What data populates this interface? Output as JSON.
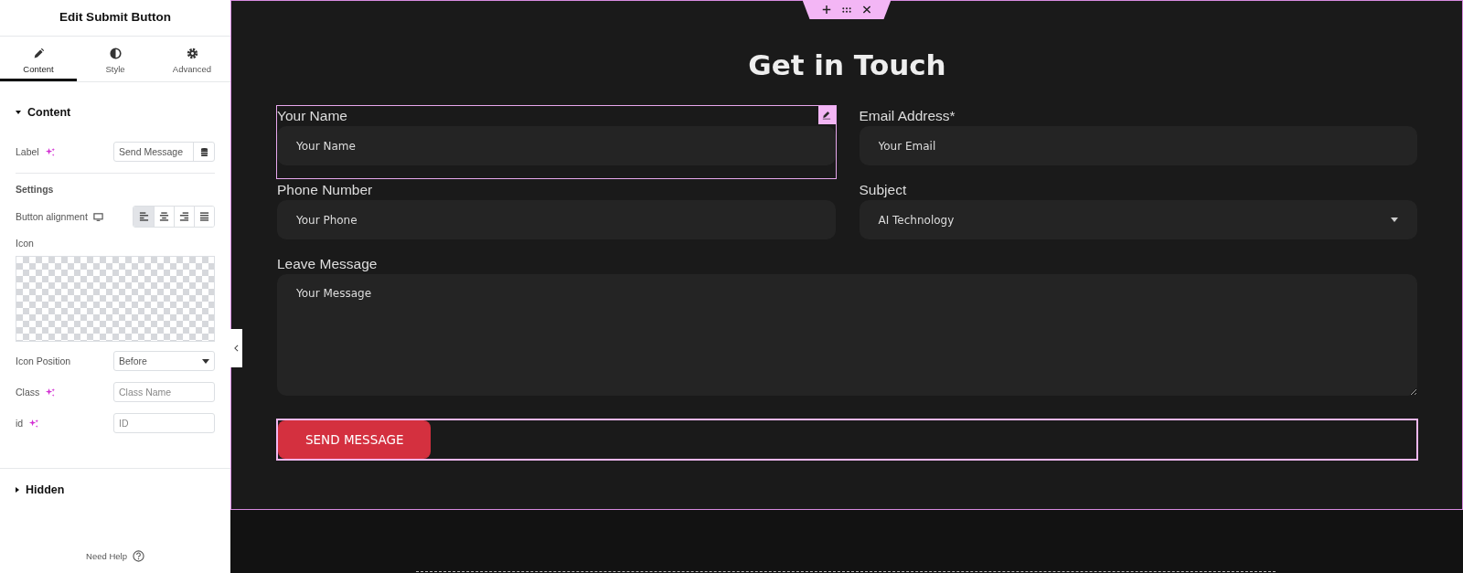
{
  "panel": {
    "title": "Edit Submit Button",
    "tabs": [
      {
        "label": "Content",
        "kind": "pencil",
        "selected": true
      },
      {
        "label": "Style",
        "kind": "contrast",
        "selected": false
      },
      {
        "label": "Advanced",
        "kind": "gear",
        "selected": false
      }
    ],
    "content_section": {
      "title": "Content",
      "expanded": true
    },
    "label_field": {
      "label": "Label",
      "value": "Send Message"
    },
    "settings_heading": "Settings",
    "alignment": {
      "label": "Button alignment",
      "options": [
        {
          "kind": "left",
          "selected": true
        },
        {
          "kind": "center",
          "selected": false
        },
        {
          "kind": "right",
          "selected": false
        },
        {
          "kind": "justify",
          "selected": false
        }
      ]
    },
    "icon_label": "Icon",
    "icon_position": {
      "label": "Icon Position",
      "value": "Before"
    },
    "class_field": {
      "label": "Class",
      "placeholder": "Class Name"
    },
    "id_field": {
      "label": "id",
      "placeholder": "ID"
    },
    "hidden_section": {
      "title": "Hidden",
      "expanded": false
    },
    "help": "Need Help"
  },
  "canvas": {
    "heading": "Get in Touch",
    "fields": [
      {
        "kind": "text",
        "label": "Your Name",
        "placeholder": "Your Name",
        "selected": true
      },
      {
        "kind": "text",
        "label": "Email Address*",
        "placeholder": "Your Email",
        "selected": false
      },
      {
        "kind": "text",
        "label": "Phone Number",
        "placeholder": "Your Phone",
        "selected": false
      },
      {
        "kind": "select",
        "label": "Subject",
        "value": "AI Technology",
        "selected": false
      },
      {
        "kind": "textarea",
        "label": "Leave Message",
        "placeholder": "Your Message",
        "selected": false
      }
    ],
    "submit": {
      "label": "SEND MESSAGE",
      "selected": true
    }
  }
}
